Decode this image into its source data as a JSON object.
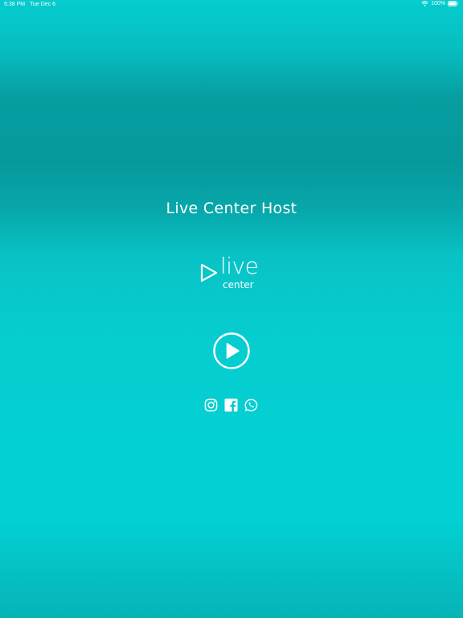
{
  "status_bar": {
    "time": "5:38 PM",
    "date": "Tue Dec 6",
    "battery": "100%"
  },
  "app": {
    "title": "Live Center Host"
  },
  "logo": {
    "word_main": "live",
    "word_sub": "center"
  },
  "icons": {
    "play": "play-circle-icon",
    "instagram": "instagram-icon",
    "facebook": "facebook-icon",
    "whatsapp": "whatsapp-icon"
  },
  "colors": {
    "background_top": "#05cccf",
    "background_band": "#06999c",
    "background_main": "#03d0d3",
    "foreground": "#ffffff"
  }
}
